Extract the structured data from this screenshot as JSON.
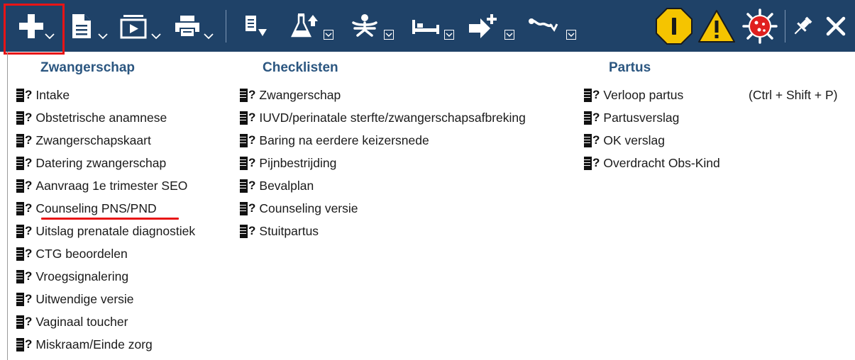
{
  "toolbar": {
    "accent_color": "#1f4268",
    "highlight_color": "#e81416",
    "icons": [
      "plus-icon",
      "document-icon",
      "play-doc-icon",
      "printer-icon",
      "list-down-icon",
      "flask-up-icon",
      "person-icon",
      "bed-icon",
      "arrow-plus-icon",
      "stethoscope-icon",
      "info-octagon-icon",
      "warning-triangle-icon",
      "virus-icon",
      "pin-icon",
      "close-icon"
    ]
  },
  "columns": [
    {
      "heading": "Zwangerschap",
      "items": [
        "Intake",
        "Obstetrische anamnese",
        "Zwangerschapskaart",
        "Datering zwangerschap",
        "Aanvraag 1e trimester SEO",
        "Counseling PNS/PND",
        "Uitslag prenatale diagnostiek",
        "CTG beoordelen",
        "Vroegsignalering",
        "Uitwendige versie",
        "Vaginaal toucher",
        "Miskraam/Einde zorg"
      ]
    },
    {
      "heading": "Checklisten",
      "items": [
        "Zwangerschap",
        "IUVD/perinatale sterfte/zwangerschapsafbreking",
        "Baring na eerdere keizersnede",
        "Pijnbestrijding",
        "Bevalplan",
        "Counseling versie",
        "Stuitpartus"
      ]
    },
    {
      "heading": "Partus",
      "items": [
        "Verloop partus",
        "Partusverslag",
        "OK verslag",
        "Overdracht Obs-Kind"
      ]
    }
  ],
  "shortcut": "(Ctrl + Shift + P)"
}
